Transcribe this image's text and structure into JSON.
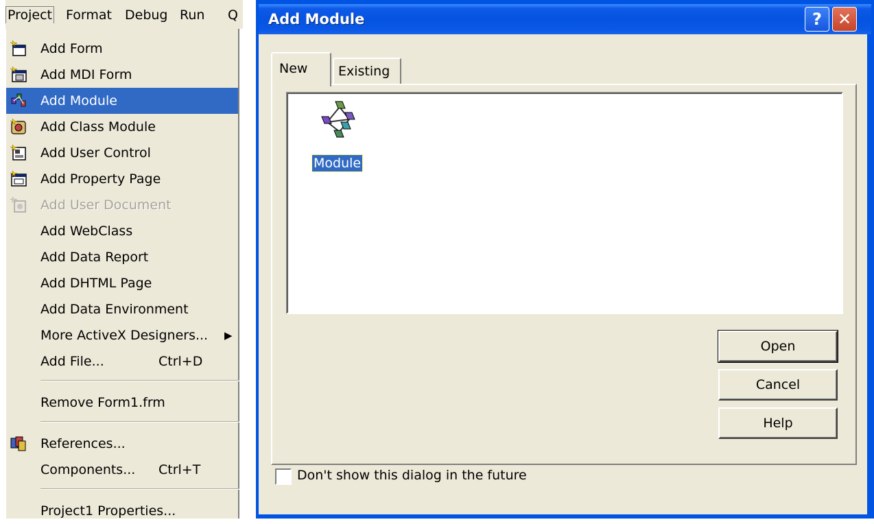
{
  "menubar": {
    "items": [
      {
        "label": "Project",
        "active": true
      },
      {
        "label": "Format"
      },
      {
        "label": "Debug"
      },
      {
        "label": "Run"
      },
      {
        "label": "Q"
      }
    ]
  },
  "menu": {
    "items": [
      {
        "label": "Add Form",
        "icon": "form-icon"
      },
      {
        "label": "Add MDI Form",
        "icon": "mdi-form-icon"
      },
      {
        "label": "Add Module",
        "icon": "module-icon",
        "highlighted": true
      },
      {
        "label": "Add Class Module",
        "icon": "class-module-icon"
      },
      {
        "label": "Add User Control",
        "icon": "user-control-icon"
      },
      {
        "label": "Add Property Page",
        "icon": "property-page-icon"
      },
      {
        "label": "Add User Document",
        "icon": "user-document-icon",
        "disabled": true
      },
      {
        "label": "Add WebClass"
      },
      {
        "label": "Add Data Report"
      },
      {
        "label": "Add DHTML Page"
      },
      {
        "label": "Add Data Environment"
      },
      {
        "label": "More ActiveX Designers...",
        "submenu": true
      },
      {
        "label": "Add File...",
        "shortcut": "Ctrl+D"
      },
      {
        "label": "Remove Form1.frm"
      },
      {
        "label": "References...",
        "icon": "references-icon"
      },
      {
        "label": "Components...",
        "shortcut": "Ctrl+T"
      },
      {
        "label": "Project1 Properties..."
      }
    ]
  },
  "dialog": {
    "title": "Add Module",
    "titlebar_help": "?",
    "titlebar_close": "✕",
    "tabs": [
      {
        "label": "New",
        "active": true
      },
      {
        "label": "Existing"
      }
    ],
    "items": [
      {
        "label": "Module",
        "icon": "module-icon",
        "selected": true
      }
    ],
    "buttons": {
      "open": "Open",
      "cancel": "Cancel",
      "help": "Help"
    },
    "checkbox": {
      "label": "Don't show this dialog in the future",
      "checked": false
    }
  },
  "colors": {
    "highlight": "#316ac5",
    "face": "#ece9d8",
    "titlebar": "#0054e3"
  }
}
